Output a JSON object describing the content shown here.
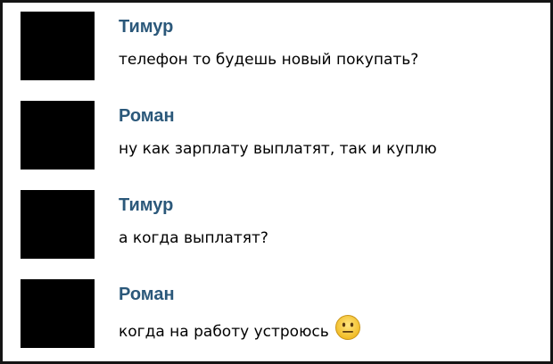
{
  "messages": [
    {
      "author": "Тимур",
      "text": "телефон то будешь новый покупать?"
    },
    {
      "author": "Роман",
      "text": "ну как зарплату выплатят, так и куплю"
    },
    {
      "author": "Тимур",
      "text": "а когда выплатят?"
    },
    {
      "author": "Роман",
      "text": "когда на работу устроюсь",
      "emoji": "neutral-face-emoji"
    }
  ],
  "colors": {
    "author_name": "#2b587a",
    "emoji_face": "#f5c52a"
  }
}
